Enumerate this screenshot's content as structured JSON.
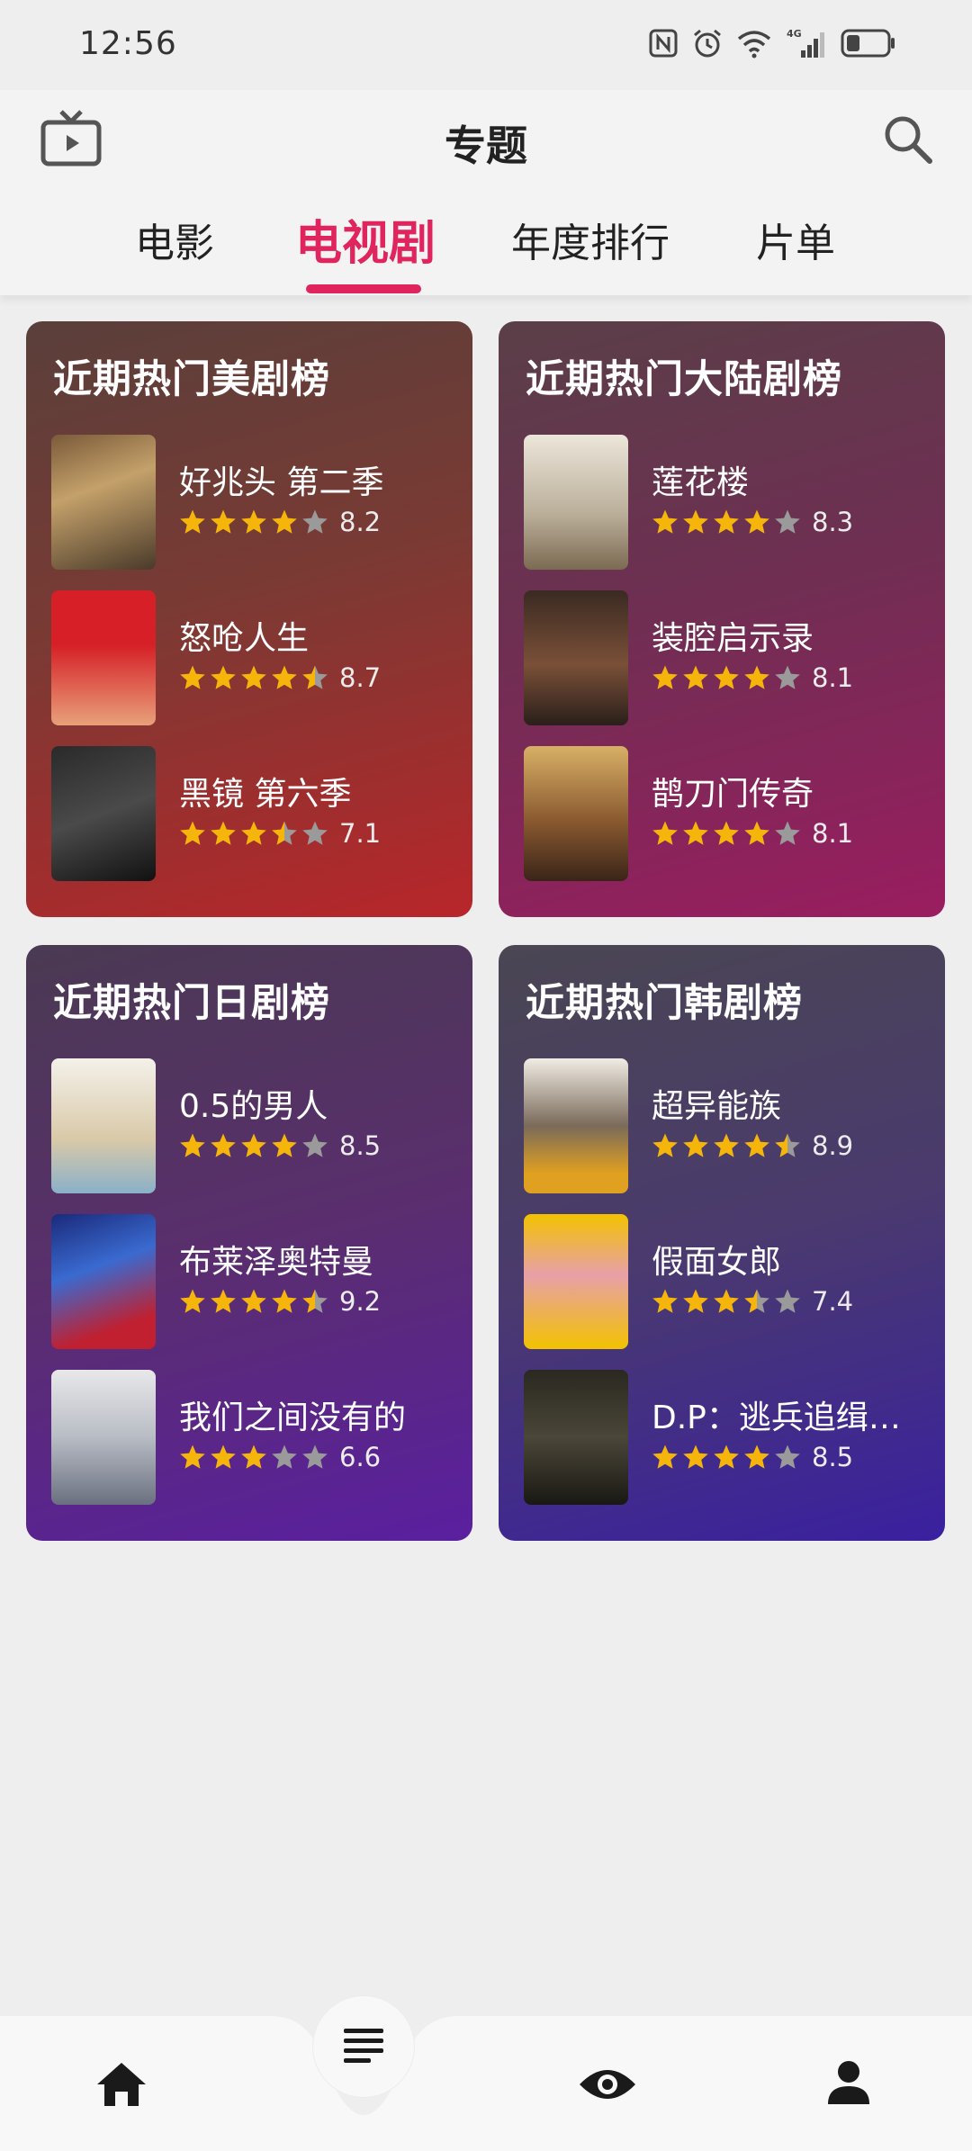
{
  "status": {
    "time": "12:56"
  },
  "header": {
    "title": "专题"
  },
  "tabs": [
    {
      "label": "电影",
      "active": false
    },
    {
      "label": "电视剧",
      "active": true
    },
    {
      "label": "年度排行",
      "active": false
    },
    {
      "label": "片单",
      "active": false
    }
  ],
  "colors": {
    "accent": "#e0245e",
    "star_filled": "#f5b50a",
    "star_empty": "#9a9a9a"
  },
  "cards": [
    {
      "title": "近期热门美剧榜",
      "items": [
        {
          "title": "好兆头 第二季",
          "rating": 8.2,
          "stars": 4,
          "score": "8.2"
        },
        {
          "title": "怒呛人生",
          "rating": 8.7,
          "stars": 4.5,
          "score": "8.7"
        },
        {
          "title": "黑镜 第六季",
          "rating": 7.1,
          "stars": 3.5,
          "score": "7.1"
        }
      ]
    },
    {
      "title": "近期热门大陆剧榜",
      "items": [
        {
          "title": "莲花楼",
          "rating": 8.3,
          "stars": 4,
          "score": "8.3"
        },
        {
          "title": "装腔启示录",
          "rating": 8.1,
          "stars": 4,
          "score": "8.1"
        },
        {
          "title": "鹊刀门传奇",
          "rating": 8.1,
          "stars": 4,
          "score": "8.1"
        }
      ]
    },
    {
      "title": "近期热门日剧榜",
      "items": [
        {
          "title": "0.5的男人",
          "rating": 8.5,
          "stars": 4,
          "score": "8.5"
        },
        {
          "title": "布莱泽奥特曼",
          "rating": 9.2,
          "stars": 4.5,
          "score": "9.2"
        },
        {
          "title": "我们之间没有的",
          "rating": 6.6,
          "stars": 3,
          "score": "6.6"
        }
      ]
    },
    {
      "title": "近期热门韩剧榜",
      "items": [
        {
          "title": "超异能族",
          "rating": 8.9,
          "stars": 4.5,
          "score": "8.9"
        },
        {
          "title": "假面女郎",
          "rating": 7.4,
          "stars": 3.5,
          "score": "7.4"
        },
        {
          "title": "D.P：逃兵追缉…",
          "rating": 8.5,
          "stars": 4,
          "score": "8.5"
        }
      ]
    }
  ],
  "bottom_nav": [
    {
      "icon": "home-icon"
    },
    {
      "icon": "list-icon",
      "active": true
    },
    {
      "icon": "eye-icon"
    },
    {
      "icon": "profile-icon"
    }
  ]
}
